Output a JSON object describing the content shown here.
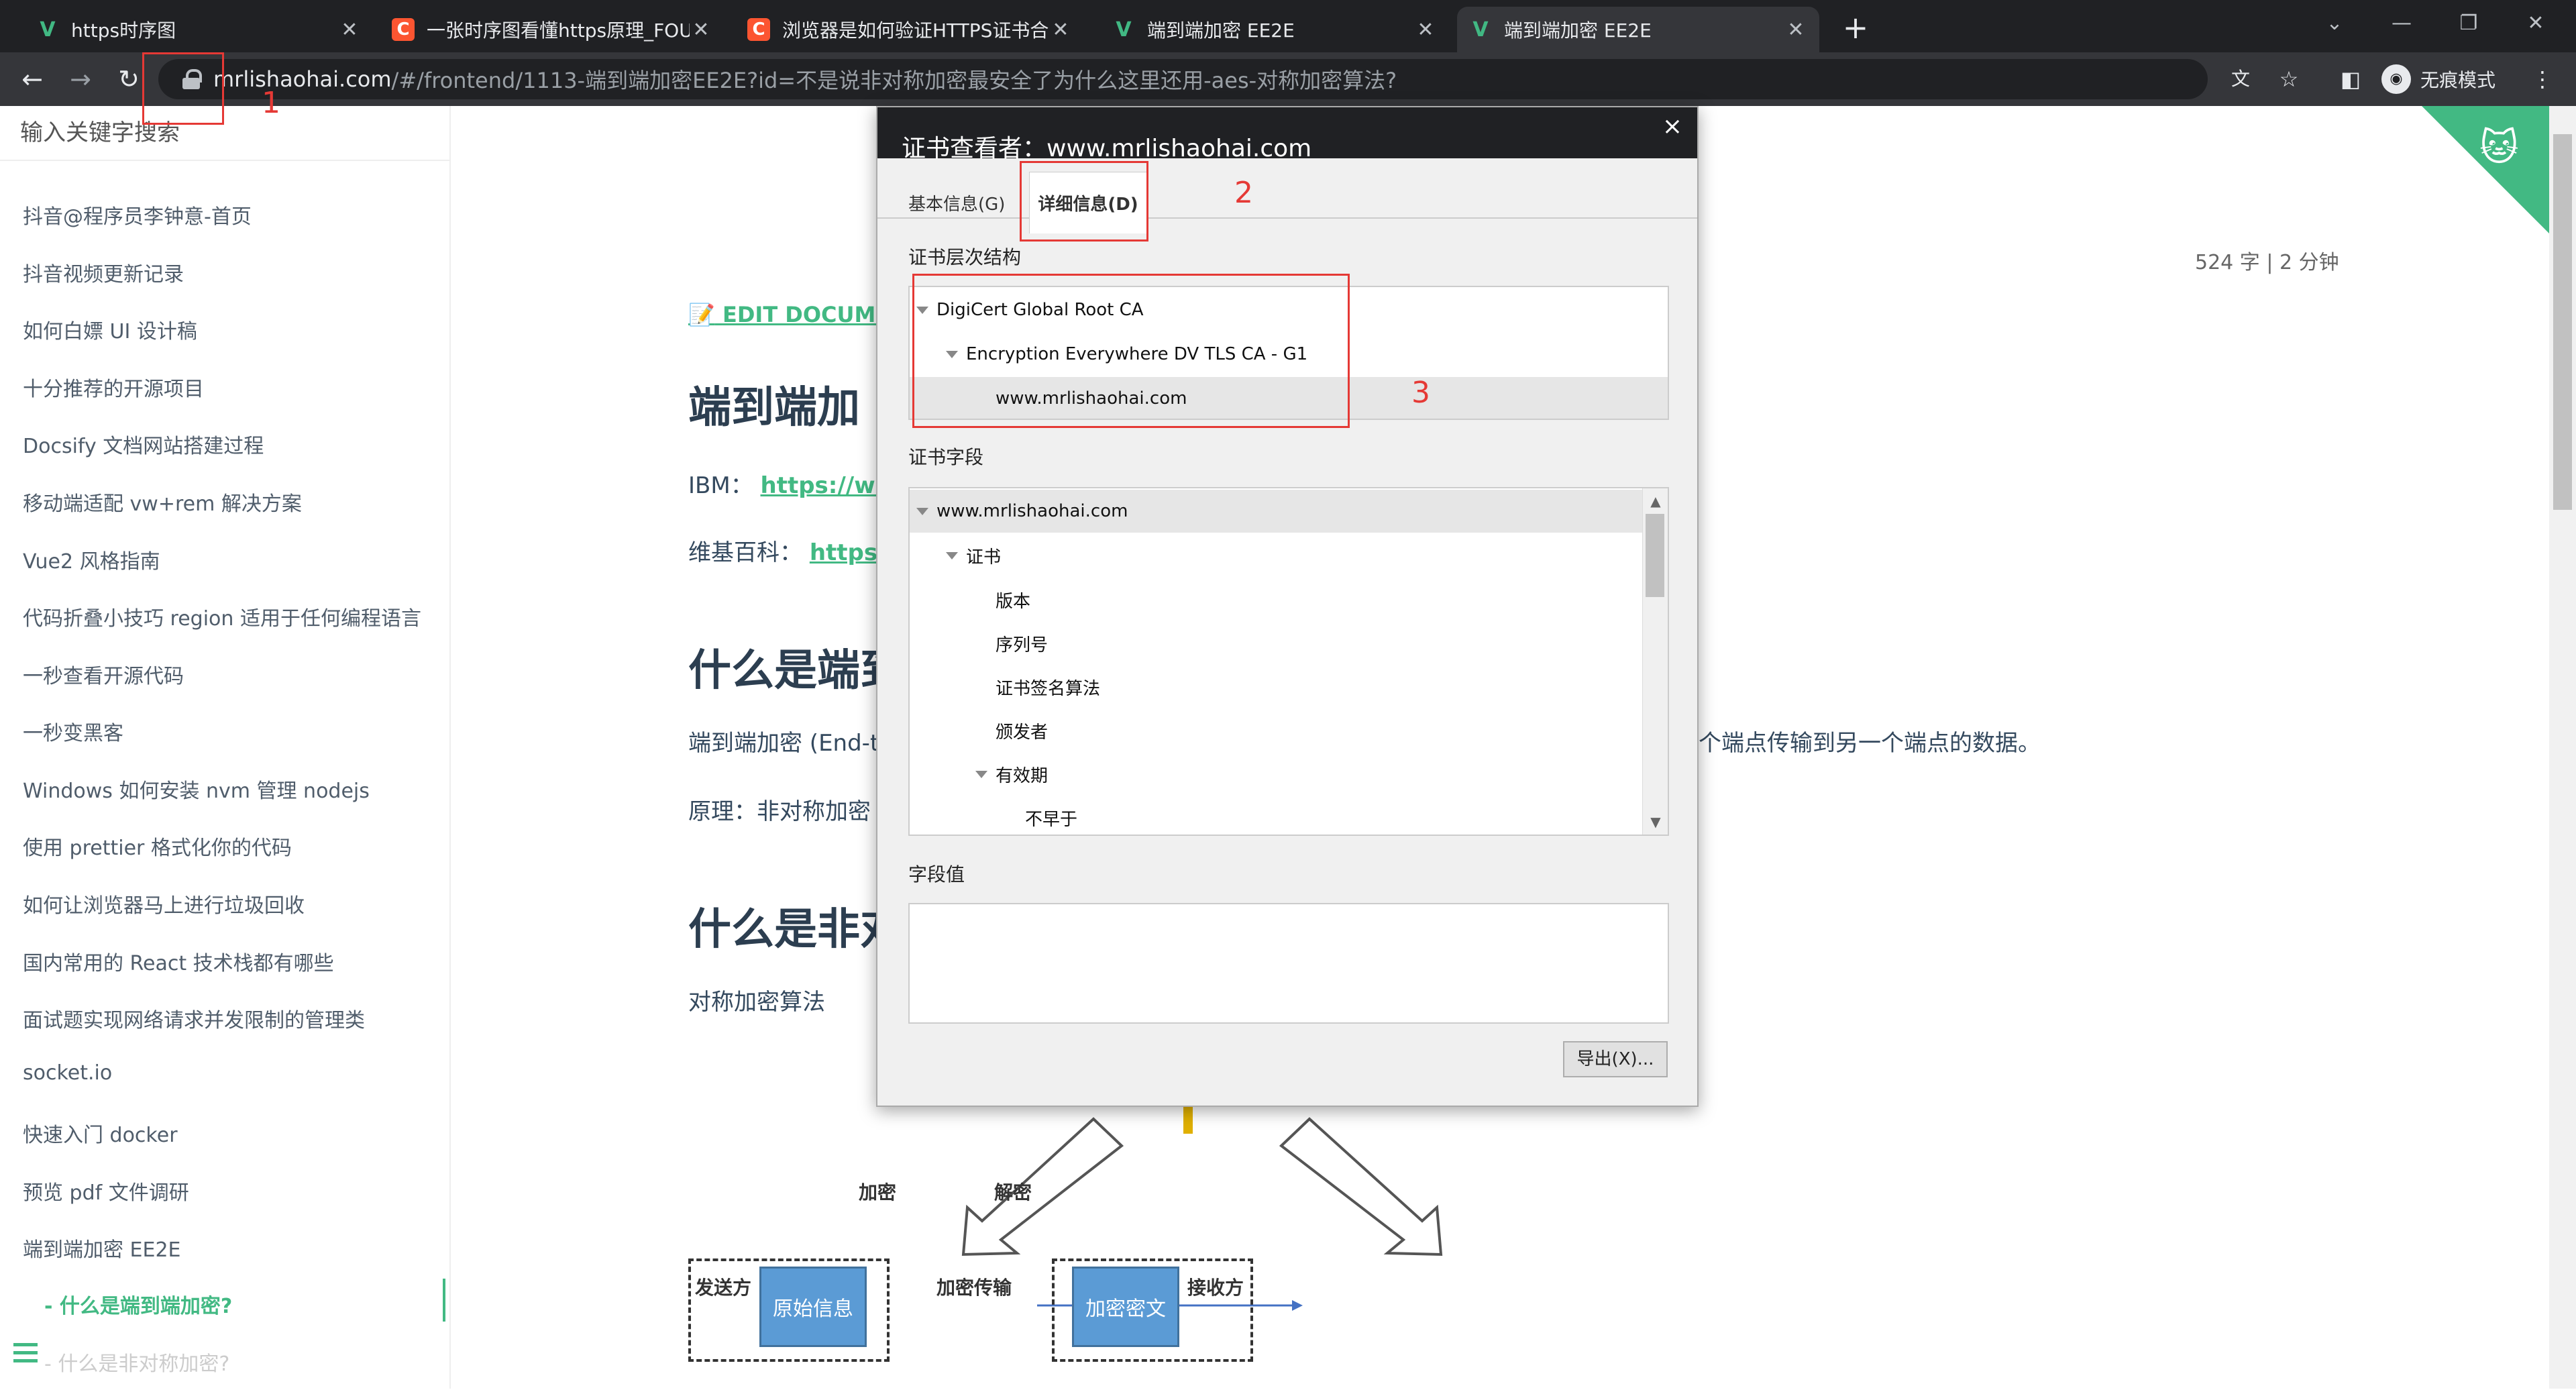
{
  "tabs": [
    {
      "icon": "vue-icon",
      "title": "https时序图"
    },
    {
      "icon": "csdn-icon",
      "title": "一张时序图看懂https原理_FOUR"
    },
    {
      "icon": "csdn-icon",
      "title": "浏览器是如何验证HTTPS证书合法"
    },
    {
      "icon": "vue-icon",
      "title": "端到端加密 EE2E"
    },
    {
      "icon": "vue-icon",
      "title": "端到端加密 EE2E"
    }
  ],
  "address": {
    "host": "mrlishaohai.com",
    "path": "/#/frontend/1113-端到端加密EE2E?id=不是说非对称加密最安全了为什么这里还用-aes-对称加密算法?"
  },
  "toolbar": {
    "incognito_label": "无痕模式"
  },
  "sidebar": {
    "search_placeholder": "输入关键字搜索",
    "items": [
      "抖音@程序员李钟意-首页",
      "抖音视频更新记录",
      "如何白嫖 UI 设计稿",
      "十分推荐的开源项目",
      "Docsify 文档网站搭建过程",
      "移动端适配 vw+rem 解决方案",
      "Vue2 风格指南",
      "代码折叠小技巧 region 适用于任何编程语言",
      "一秒查看开源代码",
      "一秒变黑客",
      "Windows 如何安装 nvm 管理 nodejs",
      "使用 prettier 格式化你的代码",
      "如何让浏览器马上进行垃圾回收",
      "国内常用的 React 技术栈都有哪些",
      "面试题实现网络请求并发限制的管理类",
      "socket.io",
      "快速入门 docker",
      "预览 pdf 文件调研",
      "端到端加密 EE2E"
    ],
    "sub_active": "- 什么是端到端加密?",
    "sub_next": "- 什么是非对称加密?"
  },
  "main": {
    "edit_link": "EDIT DOCUMENT",
    "h1": "端到端加",
    "ibm_label": "IBM：",
    "ibm_link": "https://www",
    "wiki_label": "维基百科：",
    "wiki_link": "https:/",
    "h2a": "什么是端到",
    "p1": "端到端加密 (End-t",
    "p1_right": "个端点传输到另一个端点的数据。",
    "p2": "原理：非对称加密",
    "h2b": "什么是非对",
    "p3": "对称加密算法",
    "wordcount": "524 字 | 2 分钟"
  },
  "diagram": {
    "encrypt": "加密",
    "decrypt": "解密",
    "sender": "发送方",
    "plaintext": "原始信息",
    "transfer": "加密传输",
    "ciphertext": "加密密文",
    "receiver": "接收方"
  },
  "dialog": {
    "title": "证书查看者：www.mrlishaohai.com",
    "tab_general": "基本信息(G)",
    "tab_details": "详细信息(D)",
    "hierarchy_label": "证书层次结构",
    "hierarchy": [
      "DigiCert Global Root CA",
      "Encryption Everywhere DV TLS CA - G1",
      "www.mrlishaohai.com"
    ],
    "fields_label": "证书字段",
    "fields": [
      "www.mrlishaohai.com",
      "证书",
      "版本",
      "序列号",
      "证书签名算法",
      "颁发者",
      "有效期",
      "不早于"
    ],
    "value_label": "字段值",
    "export_button": "导出(X)..."
  },
  "annotations": {
    "n1": "1",
    "n2": "2",
    "n3": "3"
  },
  "colors": {
    "accent": "#42b983",
    "annotation": "#e53935",
    "chrome_dark": "#202124"
  }
}
